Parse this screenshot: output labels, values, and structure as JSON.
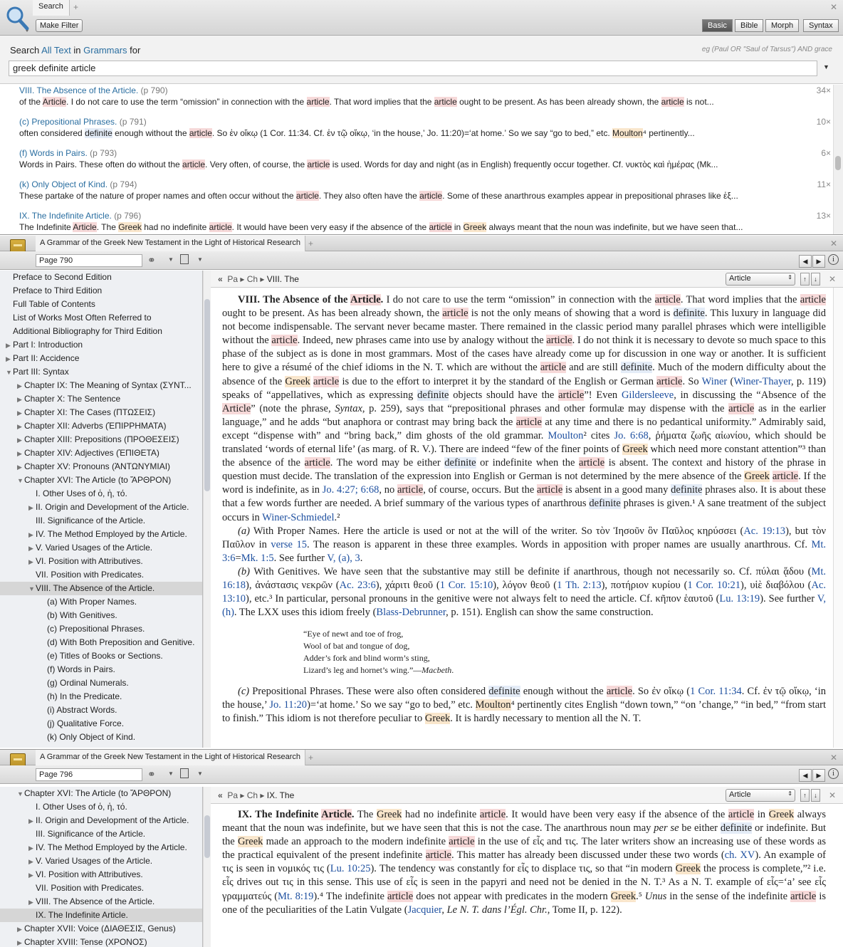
{
  "search": {
    "tab_label": "Search",
    "make_filter": "Make Filter",
    "modes": [
      "Basic",
      "Bible",
      "Morph",
      "Syntax"
    ],
    "label_search": "Search",
    "label_all_text": "All Text",
    "label_in": "in",
    "label_grammars": "Grammars",
    "label_for": "for",
    "example_hint": "eg (Paul OR \"Saul of Tarsus\") AND grace",
    "query": "greek definite article",
    "results": [
      {
        "title": "VIII. The Absence of the Article.",
        "page": "(p 790)",
        "count": "34×",
        "snippet": "of the <span class='hl-red'>Article</span>. I do not care to use the term “omission” in connection with the <span class='hl-red'>article</span>. That word implies that the <span class='hl-red'>article</span> ought to be present. As has been already shown, the <span class='hl-red'>article</span> is not..."
      },
      {
        "title": "(c) Prepositional Phrases.",
        "page": "(p 791)",
        "count": "10×",
        "snippet": "often considered <span class='hl-blue'>definite</span> enough without the <span class='hl-red'>article</span>. So ἐν οἴκῳ (1 Cor. 11:34. Cf. ἐν τῷ οἴκῳ, ‘in the house,’ Jo. 11:20)=‘at home.’ So we say “go to bed,” etc. <span class='hl-org'>Moulton</span>⁴ pertinently..."
      },
      {
        "title": "(f) Words in Pairs.",
        "page": "(p 793)",
        "count": "6×",
        "snippet": "Words in Pairs. These often do without the <span class='hl-red'>article</span>. Very often, of course, the <span class='hl-red'>article</span> is used. Words for day and night (as in English) frequently occur together. Cf. νυκτὸς καὶ ἡμέρας (Mk..."
      },
      {
        "title": "(k) Only Object of Kind.",
        "page": "(p 794)",
        "count": "11×",
        "snippet": "These partake of the nature of proper names and often occur without the <span class='hl-red'>article</span>. They also often have the <span class='hl-red'>article</span>. Some of these anarthrous examples appear in prepositional phrases like ἐξ..."
      },
      {
        "title": "IX. The Indefinite Article.",
        "page": "(p 796)",
        "count": "13×",
        "snippet": "The Indefinite <span class='hl-red'>Article</span>. The <span class='hl-org'>Greek</span> had no indefinite <span class='hl-red'>article</span>. It would have been very easy if the absence of the <span class='hl-red'>article</span> in <span class='hl-org'>Greek</span> always meant that the noun was indefinite, but we have seen that..."
      }
    ]
  },
  "book1": {
    "tab_title": "A Grammar of the Greek New Testament in the Light of Historical Research",
    "page": "Page 790",
    "crumb": [
      "Pa",
      "Ch",
      "VIII. The"
    ],
    "select": "Article",
    "toc": [
      {
        "label": "Preface to Second Edition",
        "lvl": 0,
        "tri": ""
      },
      {
        "label": "Preface to Third Edition",
        "lvl": 0,
        "tri": ""
      },
      {
        "label": "Full Table of Contents",
        "lvl": 0,
        "tri": ""
      },
      {
        "label": "List of Works Most Often Referred to",
        "lvl": 0,
        "tri": ""
      },
      {
        "label": "Additional Bibliography for Third Edition",
        "lvl": 0,
        "tri": ""
      },
      {
        "label": "Part I: Introduction",
        "lvl": 0,
        "tri": "▶"
      },
      {
        "label": "Part II: Accidence",
        "lvl": 0,
        "tri": "▶"
      },
      {
        "label": "Part III: Syntax",
        "lvl": 0,
        "tri": "▼"
      },
      {
        "label": "Chapter IX: The Meaning of Syntax (ΣΥΝΤ...",
        "lvl": 1,
        "tri": "▶"
      },
      {
        "label": "Chapter X: The Sentence",
        "lvl": 1,
        "tri": "▶"
      },
      {
        "label": "Chapter XI: The Cases (ΠΤΩΣΕΙΣ)",
        "lvl": 1,
        "tri": "▶"
      },
      {
        "label": "Chapter XII: Adverbs (ἘΠΙΡΡΗΜΑΤΑ)",
        "lvl": 1,
        "tri": "▶"
      },
      {
        "label": "Chapter XIII: Prepositions (ΠΡΟΘΕΣΕΙΣ)",
        "lvl": 1,
        "tri": "▶"
      },
      {
        "label": "Chapter XIV: Adjectives (ἘΠΙΘΕΤΑ)",
        "lvl": 1,
        "tri": "▶"
      },
      {
        "label": "Chapter XV: Pronouns (ἈΝΤΩΝΥΜΙΑΙ)",
        "lvl": 1,
        "tri": "▶"
      },
      {
        "label": "Chapter XVI: The Article (to ἌΡΘΡΟΝ)",
        "lvl": 1,
        "tri": "▼"
      },
      {
        "label": "I. Other Uses of ὁ, ἡ, τό.",
        "lvl": 2,
        "tri": ""
      },
      {
        "label": "II. Origin and Development of the Article.",
        "lvl": 2,
        "tri": "▶"
      },
      {
        "label": "III. Significance of the Article.",
        "lvl": 2,
        "tri": ""
      },
      {
        "label": "IV. The Method Employed by the Article.",
        "lvl": 2,
        "tri": "▶"
      },
      {
        "label": "V. Varied Usages of the Article.",
        "lvl": 2,
        "tri": "▶"
      },
      {
        "label": "VI. Position with Attributives.",
        "lvl": 2,
        "tri": "▶"
      },
      {
        "label": "VII. Position with Predicates.",
        "lvl": 2,
        "tri": ""
      },
      {
        "label": "VIII. The Absence of the Article.",
        "lvl": 2,
        "tri": "▼",
        "sel": true
      },
      {
        "label": "(a) With Proper Names.",
        "lvl": 3,
        "tri": ""
      },
      {
        "label": "(b) With Genitives.",
        "lvl": 3,
        "tri": ""
      },
      {
        "label": "(c) Prepositional Phrases.",
        "lvl": 3,
        "tri": ""
      },
      {
        "label": "(d) With Both Preposition and Genitive.",
        "lvl": 3,
        "tri": ""
      },
      {
        "label": "(e) Titles of Books or Sections.",
        "lvl": 3,
        "tri": ""
      },
      {
        "label": "(f) Words in Pairs.",
        "lvl": 3,
        "tri": ""
      },
      {
        "label": "(g) Ordinal Numerals.",
        "lvl": 3,
        "tri": ""
      },
      {
        "label": "(h) In the Predicate.",
        "lvl": 3,
        "tri": ""
      },
      {
        "label": "(i) Abstract Words.",
        "lvl": 3,
        "tri": ""
      },
      {
        "label": "(j) Qualitative Force.",
        "lvl": 3,
        "tri": ""
      },
      {
        "label": "(k) Only Object of Kind.",
        "lvl": 3,
        "tri": ""
      }
    ],
    "paragraphs": [
      "<b>VIII. The Absence of the <span class='hl-red'>Article</span>.</b> I do not care to use the term “omission” in connection with the <span class='hl-red'>article</span>. That word implies that the <span class='hl-red'>article</span> ought to be present. As has been already shown, the <span class='hl-red'>article</span> is not the only means of showing that a word is <span class='hl-blue'>definite</span>. This luxury in language did not become indispensable. The servant never became master. There remained in the classic period many parallel phrases which were intelligible without the <span class='hl-red'>article</span>. Indeed, new phrases came into use by analogy without the <span class='hl-red'>article</span>. I do not think it is necessary to devote so much space to this phase of the subject as is done in most grammars. Most of the cases have already come up for discussion in one way or another. It is sufficient here to give a résumé of the chief idioms in the N. T. which are without the <span class='hl-red'>article</span> and are still <span class='hl-blue'>definite</span>. Much of the modern difficulty about the absence of the <span class='hl-org'>Greek</span> <span class='hl-red'>article</span> is due to the effort to interpret it by the standard of the English or German <span class='hl-red'>article</span>. So <span class='lnk'>Winer</span> (<span class='lnk'>Winer-Thayer</span>, p. 119) speaks of “appellatives, which as expressing <span class='hl-blue'>definite</span> objects should have the <span class='hl-red'>article</span>”! Even <span class='lnk'>Gildersleeve</span>, in discussing the “Absence of the <span class='hl-red'>Article</span>” (note the phrase, <i>Syntax</i>, p. 259), says that “prepositional phrases and other formulæ may dispense with the <span class='hl-red'>article</span> as in the earlier language,” and he adds “but anaphora or contrast may bring back the <span class='hl-red'>article</span> at any time and there is no pedantical uniformity.” Admirably said, except “dispense with” and “bring back,” dim ghosts of the old grammar. <span class='lnk'>Moulton</span>² cites <span class='lnk'>Jo. 6:68</span>, ῥήματα ζωῆς αἰωνίου, which should be translated ‘words of eternal life’ (as marg. of R. V.). There are indeed “few of the finer points of <span class='hl-org'>Greek</span> which need more constant attention”³ than the absence of the <span class='hl-red'>article</span>. The word may be either <span class='hl-blue'>definite</span> or indefinite when the <span class='hl-red'>article</span> is absent. The context and history of the phrase in question must decide. The translation of the expression into English or German is not determined by the mere absence of the <span class='hl-org'>Greek</span> <span class='hl-red'>article</span>. If the word is indefinite, as in <span class='lnk'>Jo. 4:27; 6:68</span>, no <span class='hl-red'>article</span>, of course, occurs. But the <span class='hl-red'>article</span> is absent in a good many <span class='hl-blue'>definite</span> phrases also. It is about these that a few words further are needed. A brief summary of the various types of anarthrous <span class='hl-blue'>definite</span> phrases is given.¹ A sane treatment of the subject occurs in <span class='lnk'>Winer-Schmiedel</span>.²",
      "<i>(a)</i> With Proper Names. Here the article is used or not at the will of the writer. So τὸν Ἰησοῦν ὃν Παῦλος κηρύσσει (<span class='lnk'>Ac. 19:13</span>), but τὸν Παῦλον in <span class='lnk'>verse 15</span>. The reason is apparent in these three examples. Words in apposition with proper names are usually anarthrous. Cf. <span class='lnk'>Mt. 3:6</span>=<span class='lnk'>Mk. 1:5</span>. See further <span class='lnk'>V, (a), 3</span>.",
      "<i>(b)</i> With Genitives. We have seen that the substantive may still be definite if anarthrous, though not necessarily so. Cf. πύλαι ᾅδου (<span class='lnk'>Mt. 16:18</span>), ἀνάστασις νεκρῶν (<span class='lnk'>Ac. 23:6</span>), χάριτι θεοῦ (<span class='lnk'>1 Cor. 15:10</span>), λόγον θεοῦ (<span class='lnk'>1 Th. 2:13</span>), ποτήριον κυρίου (<span class='lnk'>1 Cor. 10:21</span>), υἱὲ διαβόλου (<span class='lnk'>Ac. 13:10</span>), etc.³ In particular, personal pronouns in the genitive were not always felt to need the article. Cf. κῆπον ἑαυτοῦ (<span class='lnk'>Lu. 13:19</span>). See further <span class='lnk'>V, (h)</span>. The LXX uses this idiom freely (<span class='lnk'>Blass-Debrunner</span>, p. 151). English can show the same construction."
    ],
    "poem": [
      "“Eye of newt and toe of frog,",
      "Wool of bat and tongue of dog,",
      "Adder’s fork and blind worm’s sting,",
      "Lizard’s leg and hornet’s wing.”—<i>Macbeth</i>."
    ],
    "after_poem": "<i>(c)</i> Prepositional Phrases. These were also often considered <span class='hl-blue'>definite</span> enough without the <span class='hl-red'>article</span>. So ἐν οἴκῳ (<span class='lnk'>1 Cor. 11:34</span>. Cf. ἐν τῷ οἴκῳ, ‘in the house,’ <span class='lnk'>Jo. 11:20</span>)=‘at home.’ So we say “go to bed,” etc. <span class='hl-org'>Moulton</span>⁴ pertinently cites English “down town,” “on ’change,” “in bed,” “from start to finish.” This idiom is not therefore peculiar to <span class='hl-org'>Greek</span>. It is hardly necessary to mention all the N. T."
  },
  "book2": {
    "tab_title": "A Grammar of the Greek New Testament in the Light of Historical Research",
    "page": "Page 796",
    "crumb": [
      "Pa",
      "Ch",
      "IX. The"
    ],
    "select": "Article",
    "toc": [
      {
        "label": "Chapter XVI: The Article (to ἌΡΘΡΟΝ)",
        "lvl": 1,
        "tri": "▼"
      },
      {
        "label": "I. Other Uses of ὁ, ἡ, τό.",
        "lvl": 2,
        "tri": ""
      },
      {
        "label": "II. Origin and Development of the Article.",
        "lvl": 2,
        "tri": "▶"
      },
      {
        "label": "III. Significance of the Article.",
        "lvl": 2,
        "tri": ""
      },
      {
        "label": "IV. The Method Employed by the Article.",
        "lvl": 2,
        "tri": "▶"
      },
      {
        "label": "V. Varied Usages of the Article.",
        "lvl": 2,
        "tri": "▶"
      },
      {
        "label": "VI. Position with Attributives.",
        "lvl": 2,
        "tri": "▶"
      },
      {
        "label": "VII. Position with Predicates.",
        "lvl": 2,
        "tri": ""
      },
      {
        "label": "VIII. The Absence of the Article.",
        "lvl": 2,
        "tri": "▶"
      },
      {
        "label": "IX. The Indefinite Article.",
        "lvl": 2,
        "tri": "",
        "sel": true
      },
      {
        "label": "Chapter XVII: Voice (ΔΙΑΘΕΣΙΣ, Genus)",
        "lvl": 1,
        "tri": "▶"
      },
      {
        "label": "Chapter XVIII: Tense (ΧΡΟΝΟΣ)",
        "lvl": 1,
        "tri": "▶"
      }
    ],
    "paragraph": "<b>IX. The Indefinite <span class='hl-red'>Article</span>.</b> The <span class='hl-org'>Greek</span> had no indefinite <span class='hl-red'>article</span>. It would have been very easy if the absence of the <span class='hl-red'>article</span> in <span class='hl-org'>Greek</span> always meant that the noun was indefinite, but we have seen that this is not the case. The anarthrous noun may <i>per se</i> be either <span class='hl-blue'>definite</span> or indefinite. But the <span class='hl-org'>Greek</span> made an approach to the modern indefinite <span class='hl-red'>article</span> in the use of εἷς and τις. The later writers show an increasing use of these words as the practical equivalent of the present indefinite <span class='hl-red'>article</span>. This matter has already been discussed under these two words (<span class='lnk'>ch. XV</span>). An example of τις is seen in νομικός τις (<span class='lnk'>Lu. 10:25</span>). The tendency was constantly for εἷς to displace τις, so that “in modern <span class='hl-org'>Greek</span> the process is complete,”² i.e. εἷς drives out τις in this sense. This use of εἷς is seen in the papyri and need not be denied in the N. T.³ As a N. T. example of εἷς=‘a’ see εἷς γραμματεύς (<span class='lnk'>Mt. 8:19</span>).⁴ The indefinite <span class='hl-red'>article</span> does not appear with predicates in the modern <span class='hl-org'>Greek</span>.⁵ <i>Unus</i> in the sense of the indefinite <span class='hl-red'>article</span> is one of the peculiarities of the Latin Vulgate (<span class='lnk'>Jacquier</span>, <i>Le N. T. dans l’Égl. Chr.</i>, Tome II, p. 122)."
  }
}
